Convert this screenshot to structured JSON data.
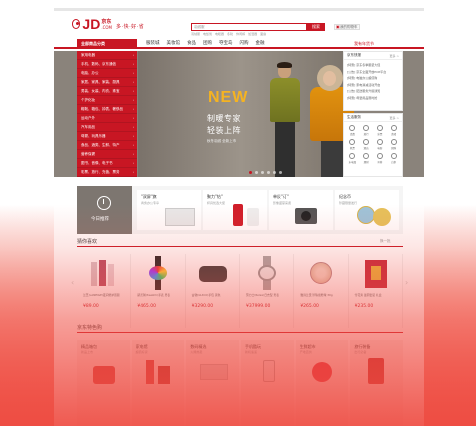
{
  "header": {
    "logo_text": "JD",
    "logo_cn": "京东",
    "logo_com": ".COM",
    "slogan": "多·快·好·省",
    "search_placeholder": "羽绒服",
    "search_button": "搜索",
    "cart_label": "我的购物车",
    "hot_words": [
      "羽绒服",
      "电饭煲",
      "电暖器",
      "冬靴",
      "休闲裤",
      "加湿器",
      "面霜"
    ]
  },
  "nav": {
    "category_title": "全部商品分类",
    "items": [
      "服装城",
      "美妆馆",
      "食品",
      "团购",
      "夺宝岛",
      "闪购",
      "金融"
    ],
    "right_label": "我有年货节"
  },
  "sidebar": {
    "items": [
      "家用电器",
      "手机、数码、京东通信",
      "电脑、办公",
      "家居、家具、家装、厨具",
      "男装、女装、内衣、珠宝",
      "个护化妆",
      "鞋靴、箱包、钟表、奢侈品",
      "运动户外",
      "汽车用品",
      "母婴、玩具乐器",
      "食品、酒类、生鲜、特产",
      "营养保健",
      "图书、音像、电子书",
      "彩票、旅行、充值、票务",
      "理财"
    ]
  },
  "banner": {
    "headline": "NEW",
    "line1": "制暖专家",
    "line2": "轻装上阵",
    "line3": "秋冬羽绒 全新上市"
  },
  "news": {
    "title": "京东快报",
    "more": "更多 >",
    "items": [
      "[特惠] 京东冬季服装大促",
      "[公告] 京东全面开放POP平台",
      "[特惠] 电脑办公超值购",
      "[特惠] 家电满减活动开启",
      "[公告] 配送服务升级通知",
      "[特惠] 母婴用品限时抢"
    ]
  },
  "services": {
    "title": "生活服务",
    "more": "更多 >",
    "items": [
      "话费",
      "旅行",
      "彩票",
      "游戏",
      "机票",
      "酒店",
      "电影",
      "团购",
      "水电煤",
      "理财",
      "众筹",
      "白条"
    ]
  },
  "today": {
    "label": "今日推荐",
    "cards": [
      {
        "title": "\"双屏\"旗",
        "sub": "商务办公专享"
      },
      {
        "title": "聚力\"钻\"",
        "sub": "杯具优选大促"
      },
      {
        "title": "单反\"订\"",
        "sub": "影像盛宴来袭"
      },
      {
        "title": "纪念币",
        "sub": "珍藏限量发行"
      }
    ]
  },
  "guess": {
    "title": "猜你喜欢",
    "change": "换一批",
    "products": [
      {
        "name": "兰芝(LANEIGE)夜间修护唇膜",
        "price": "¥89.00"
      },
      {
        "name": "斯沃琪(Swatch)手表 男表",
        "price": "¥465.00"
      },
      {
        "name": "古驰(GUCCI)手包 黑色",
        "price": "¥3290.00"
      },
      {
        "name": "劳力士(Rolex)日志型 男表",
        "price": "¥37999.00"
      },
      {
        "name": "雅诗兰黛 珍珠蜜粉球 30g",
        "price": "¥265.00"
      },
      {
        "name": "雪花秀 滋阴套装 礼盒",
        "price": "¥235.00"
      }
    ]
  },
  "specials": {
    "title": "京东特色购",
    "cards": [
      {
        "title": "精品箱包",
        "sub": "新品上市"
      },
      {
        "title": "家电馆",
        "sub": "超值好货"
      },
      {
        "title": "数码精选",
        "sub": "火爆热卖"
      },
      {
        "title": "手机酷玩",
        "sub": "新机速递"
      },
      {
        "title": "生鲜超市",
        "sub": "产地直供"
      },
      {
        "title": "旅行装备",
        "sub": "出行必备"
      }
    ]
  },
  "colors": {
    "brand_red": "#c81623",
    "price_red": "#c81623",
    "banner_gold": "#f5b321"
  }
}
